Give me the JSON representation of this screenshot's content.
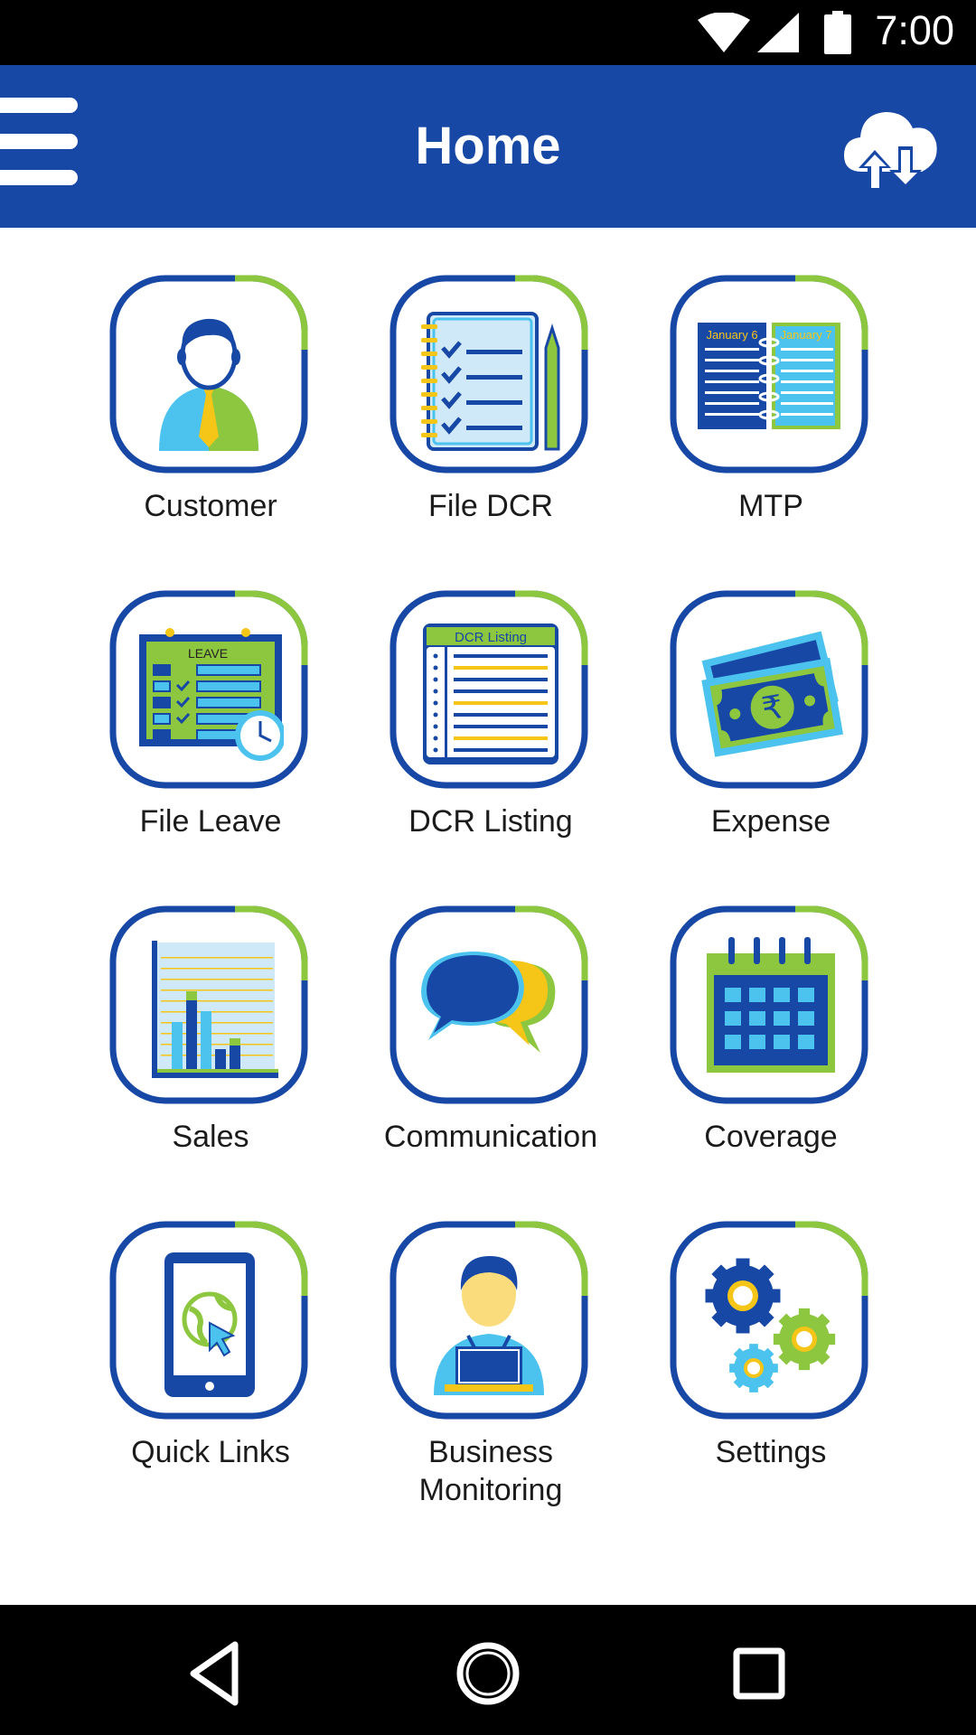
{
  "status_bar": {
    "time": "7:00",
    "icons": [
      "wifi-icon",
      "cellular-signal-icon",
      "battery-icon"
    ]
  },
  "app_bar": {
    "title": "Home",
    "left_icon": "menu-icon",
    "right_icon": "cloud-sync-icon"
  },
  "tiles": [
    {
      "label": "Customer",
      "icon": "customer-icon"
    },
    {
      "label": "File DCR",
      "icon": "checklist-icon"
    },
    {
      "label": "MTP",
      "icon": "planner-icon",
      "art_text": [
        "January 6",
        "January 7"
      ]
    },
    {
      "label": "File Leave",
      "icon": "leave-calendar-icon",
      "art_text": "LEAVE"
    },
    {
      "label": "DCR Listing",
      "icon": "list-icon",
      "art_text": "DCR Listing"
    },
    {
      "label": "Expense",
      "icon": "currency-notes-icon",
      "art_text": "₹"
    },
    {
      "label": "Sales",
      "icon": "bar-chart-icon"
    },
    {
      "label": "Communication",
      "icon": "chat-bubbles-icon"
    },
    {
      "label": "Coverage",
      "icon": "calendar-icon"
    },
    {
      "label": "Quick Links",
      "icon": "tablet-link-icon"
    },
    {
      "label": "Business\nMonitoring",
      "icon": "user-laptop-icon"
    },
    {
      "label": "Settings",
      "icon": "gears-icon"
    }
  ],
  "nav_bar": {
    "buttons": [
      "back-icon",
      "home-icon",
      "recents-icon"
    ]
  },
  "colors": {
    "brand_blue": "#1748a6",
    "accent_green": "#8dc63f",
    "light_blue": "#4cc3ee",
    "yellow": "#f5c518"
  }
}
